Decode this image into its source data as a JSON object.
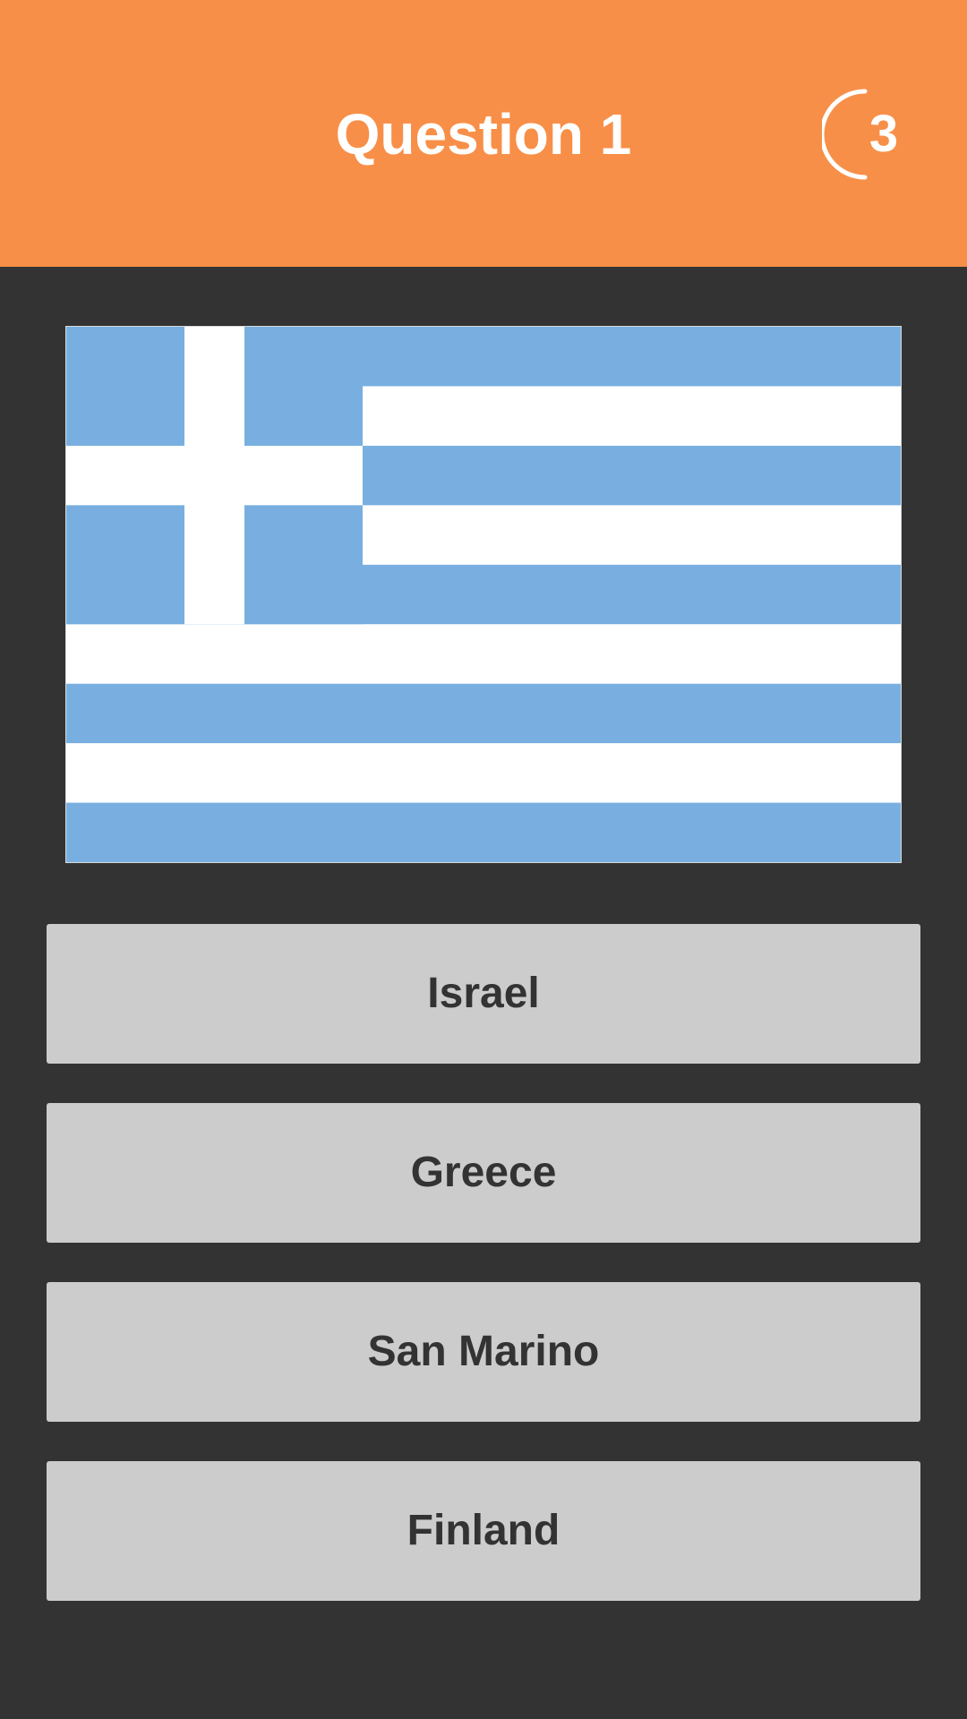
{
  "header": {
    "title": "Question 1",
    "timer_value": "3"
  },
  "flag": {
    "icon": "greece-flag-icon",
    "colors": {
      "blue": "#78AFE0",
      "white": "#FFFFFF"
    }
  },
  "answers": [
    {
      "label": "Israel"
    },
    {
      "label": "Greece"
    },
    {
      "label": "San Marino"
    },
    {
      "label": "Finland"
    }
  ],
  "colors": {
    "header_bg": "#F88F48",
    "page_bg": "#333333",
    "button_bg": "#CCCCCC",
    "button_text": "#333333"
  }
}
